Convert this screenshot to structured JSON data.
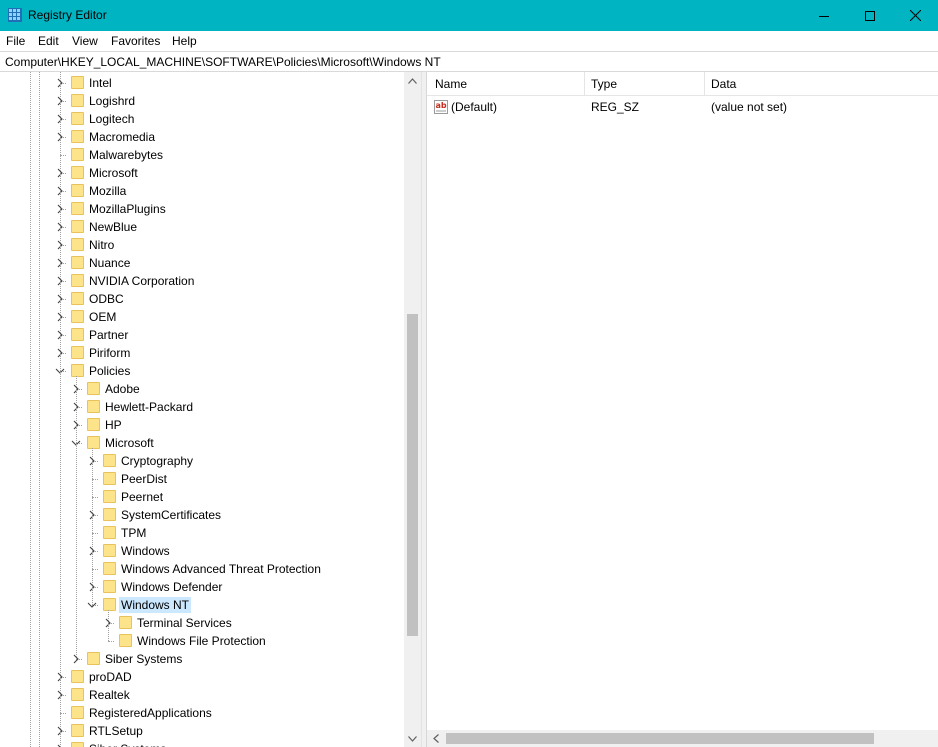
{
  "window": {
    "title": "Registry Editor"
  },
  "menu": [
    "File",
    "Edit",
    "View",
    "Favorites",
    "Help"
  ],
  "address": "Computer\\HKEY_LOCAL_MACHINE\\SOFTWARE\\Policies\\Microsoft\\Windows NT",
  "tree": [
    {
      "label": "Intel",
      "level": 0,
      "expander": "collapsed"
    },
    {
      "label": "Logishrd",
      "level": 0,
      "expander": "collapsed"
    },
    {
      "label": "Logitech",
      "level": 0,
      "expander": "collapsed"
    },
    {
      "label": "Macromedia",
      "level": 0,
      "expander": "collapsed"
    },
    {
      "label": "Malwarebytes",
      "level": 0,
      "expander": "none"
    },
    {
      "label": "Microsoft",
      "level": 0,
      "expander": "collapsed"
    },
    {
      "label": "Mozilla",
      "level": 0,
      "expander": "collapsed"
    },
    {
      "label": "MozillaPlugins",
      "level": 0,
      "expander": "collapsed"
    },
    {
      "label": "NewBlue",
      "level": 0,
      "expander": "collapsed"
    },
    {
      "label": "Nitro",
      "level": 0,
      "expander": "collapsed"
    },
    {
      "label": "Nuance",
      "level": 0,
      "expander": "collapsed"
    },
    {
      "label": "NVIDIA Corporation",
      "level": 0,
      "expander": "collapsed"
    },
    {
      "label": "ODBC",
      "level": 0,
      "expander": "collapsed"
    },
    {
      "label": "OEM",
      "level": 0,
      "expander": "collapsed"
    },
    {
      "label": "Partner",
      "level": 0,
      "expander": "collapsed"
    },
    {
      "label": "Piriform",
      "level": 0,
      "expander": "collapsed"
    },
    {
      "label": "Policies",
      "level": 0,
      "expander": "expanded"
    },
    {
      "label": "Adobe",
      "level": 1,
      "expander": "collapsed"
    },
    {
      "label": "Hewlett-Packard",
      "level": 1,
      "expander": "collapsed"
    },
    {
      "label": "HP",
      "level": 1,
      "expander": "collapsed"
    },
    {
      "label": "Microsoft",
      "level": 1,
      "expander": "expanded"
    },
    {
      "label": "Cryptography",
      "level": 2,
      "expander": "collapsed"
    },
    {
      "label": "PeerDist",
      "level": 2,
      "expander": "none"
    },
    {
      "label": "Peernet",
      "level": 2,
      "expander": "none"
    },
    {
      "label": "SystemCertificates",
      "level": 2,
      "expander": "collapsed"
    },
    {
      "label": "TPM",
      "level": 2,
      "expander": "none"
    },
    {
      "label": "Windows",
      "level": 2,
      "expander": "collapsed"
    },
    {
      "label": "Windows Advanced Threat Protection",
      "level": 2,
      "expander": "none"
    },
    {
      "label": "Windows Defender",
      "level": 2,
      "expander": "collapsed"
    },
    {
      "label": "Windows NT",
      "level": 2,
      "expander": "expanded",
      "selected": true
    },
    {
      "label": "Terminal Services",
      "level": 3,
      "expander": "collapsed"
    },
    {
      "label": "Windows File Protection",
      "level": 3,
      "expander": "none"
    },
    {
      "label": "Siber Systems",
      "level": 1,
      "expander": "collapsed"
    },
    {
      "label": "proDAD",
      "level": 0,
      "expander": "collapsed"
    },
    {
      "label": "Realtek",
      "level": 0,
      "expander": "collapsed"
    },
    {
      "label": "RegisteredApplications",
      "level": 0,
      "expander": "none"
    },
    {
      "label": "RTLSetup",
      "level": 0,
      "expander": "collapsed"
    },
    {
      "label": "Siber Systems",
      "level": 0,
      "expander": "collapsed"
    }
  ],
  "list": {
    "columns": [
      "Name",
      "Type",
      "Data"
    ],
    "rows": [
      {
        "name": "(Default)",
        "type": "REG_SZ",
        "data": "(value not set)",
        "icon": "string-value-icon"
      }
    ]
  }
}
